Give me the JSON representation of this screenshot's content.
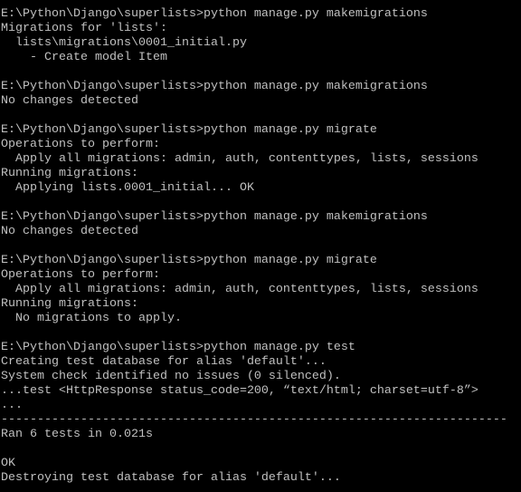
{
  "terminal": {
    "colors": {
      "background": "#000000",
      "foreground": "#c0c0c0"
    },
    "lines": [
      "E:\\Python\\Django\\superlists>python manage.py makemigrations",
      "Migrations for 'lists':",
      "  lists\\migrations\\0001_initial.py",
      "    - Create model Item",
      "",
      "E:\\Python\\Django\\superlists>python manage.py makemigrations",
      "No changes detected",
      "",
      "E:\\Python\\Django\\superlists>python manage.py migrate",
      "Operations to perform:",
      "  Apply all migrations: admin, auth, contenttypes, lists, sessions",
      "Running migrations:",
      "  Applying lists.0001_initial... OK",
      "",
      "E:\\Python\\Django\\superlists>python manage.py makemigrations",
      "No changes detected",
      "",
      "E:\\Python\\Django\\superlists>python manage.py migrate",
      "Operations to perform:",
      "  Apply all migrations: admin, auth, contenttypes, lists, sessions",
      "Running migrations:",
      "  No migrations to apply.",
      "",
      "E:\\Python\\Django\\superlists>python manage.py test",
      "Creating test database for alias 'default'...",
      "System check identified no issues (0 silenced).",
      "...test <HttpResponse status_code=200, “text/html; charset=utf-8”>",
      "...",
      "----------------------------------------------------------------------",
      "Ran 6 tests in 0.021s",
      "",
      "OK",
      "Destroying test database for alias 'default'..."
    ]
  }
}
